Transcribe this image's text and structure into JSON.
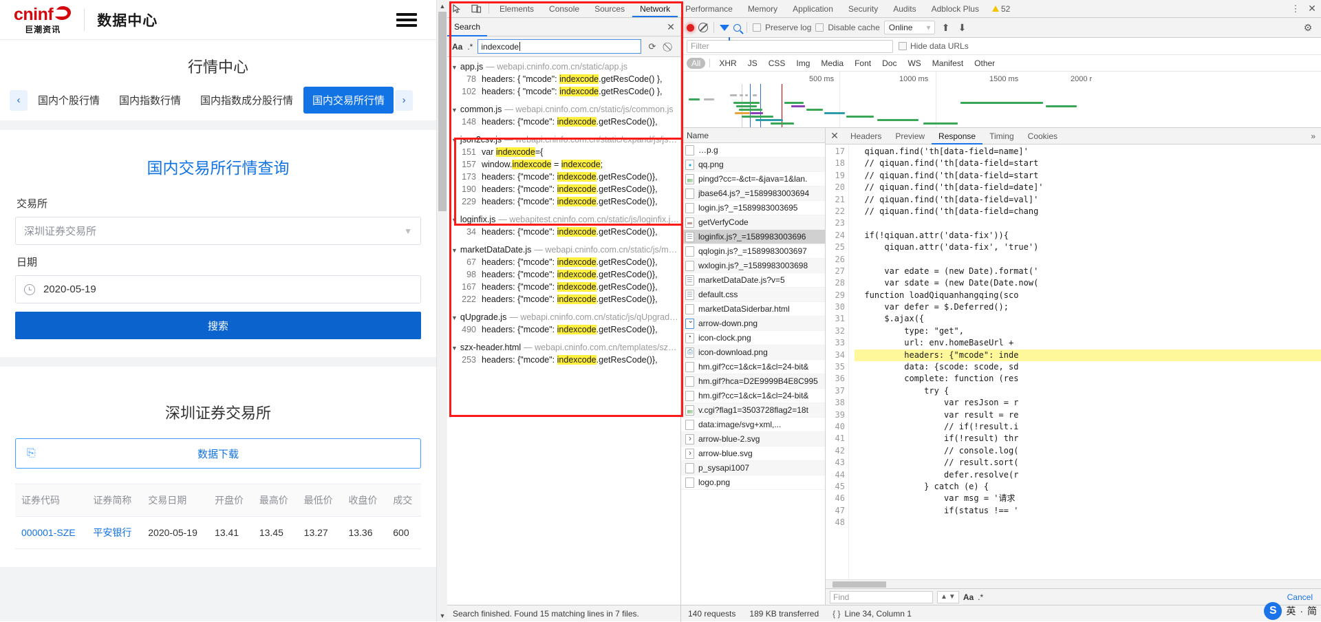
{
  "webpage": {
    "logo": {
      "top": "cninf",
      "bottom": "巨潮资讯"
    },
    "header_title": "数据中心",
    "nav": {
      "title": "行情中心",
      "prev_icon": "chevron-left-icon",
      "next_icon": "chevron-right-icon",
      "tabs": [
        {
          "label": "国内个股行情",
          "active": false
        },
        {
          "label": "国内指数行情",
          "active": false
        },
        {
          "label": "国内指数成分股行情",
          "active": false
        },
        {
          "label": "国内交易所行情",
          "active": true
        }
      ]
    },
    "query": {
      "title": "国内交易所行情查询",
      "exchange_label": "交易所",
      "exchange_value": "深圳证券交易所",
      "date_label": "日期",
      "date_value": "2020-05-19",
      "search_button": "搜索"
    },
    "results": {
      "title": "深圳证券交易所",
      "download_button": "数据下载",
      "download_icon": "download-icon",
      "columns": [
        "证券代码",
        "证券简称",
        "交易日期",
        "开盘价",
        "最高价",
        "最低价",
        "收盘价",
        "成交"
      ],
      "rows": [
        [
          "000001-SZE",
          "平安银行",
          "2020-05-19",
          "13.41",
          "13.45",
          "13.27",
          "13.36",
          "600"
        ]
      ]
    }
  },
  "devtools": {
    "tabs": [
      {
        "label": "Elements",
        "active": false
      },
      {
        "label": "Console",
        "active": false
      },
      {
        "label": "Sources",
        "active": false
      },
      {
        "label": "Network",
        "active": true
      },
      {
        "label": "Performance",
        "active": false
      },
      {
        "label": "Memory",
        "active": false
      },
      {
        "label": "Application",
        "active": false
      },
      {
        "label": "Security",
        "active": false
      },
      {
        "label": "Audits",
        "active": false
      },
      {
        "label": "Adblock Plus",
        "active": false
      }
    ],
    "warning_count": "52",
    "inspect_icon": "inspect-element-icon",
    "device_icon": "device-toolbar-icon",
    "kebab_icon": "more-options-icon",
    "close_icon": "close-icon",
    "search": {
      "panel_label": "Search",
      "close_icon": "close-icon",
      "match_case_label": "Aa",
      "regex_label": ".*",
      "query": "indexcode",
      "refresh_icon": "refresh-icon",
      "clear_icon": "clear-icon",
      "status": "Search finished. Found 15 matching lines in 7 files.",
      "files": [
        {
          "name": "app.js",
          "url": "webapi.cninfo.com.cn/static/app.js",
          "lines": [
            {
              "no": "78",
              "pre": "headers: { \"mcode\": ",
              "hit": "indexcode",
              "post": ".getResCode() },"
            },
            {
              "no": "102",
              "pre": "headers: { \"mcode\": ",
              "hit": "indexcode",
              "post": ".getResCode() },"
            }
          ]
        },
        {
          "name": "common.js",
          "url": "webapi.cninfo.com.cn/static/js/common.js",
          "lines": [
            {
              "no": "148",
              "pre": "headers: {\"mcode\": ",
              "hit": "indexcode",
              "post": ".getResCode()},"
            }
          ]
        },
        {
          "name": "json2csv.js",
          "url": "webapi.cninfo.com.cn/static/expand/js/jso…",
          "lines": [
            {
              "no": "151",
              "pre": "var ",
              "hit": "indexcode",
              "post": "={"
            },
            {
              "no": "157",
              "pre": "window.",
              "hit": "indexcode",
              "post": " = ",
              "hit2": "indexcode",
              "post2": ";"
            },
            {
              "no": "173",
              "pre": "headers: {\"mcode\": ",
              "hit": "indexcode",
              "post": ".getResCode()},"
            },
            {
              "no": "190",
              "pre": "headers: {\"mcode\": ",
              "hit": "indexcode",
              "post": ".getResCode()},"
            },
            {
              "no": "229",
              "pre": "headers: {\"mcode\": ",
              "hit": "indexcode",
              "post": ".getResCode()},"
            }
          ]
        },
        {
          "name": "loginfix.js",
          "url": "webapitest.cninfo.com.cn/static/js/loginfix.js…",
          "lines": [
            {
              "no": "34",
              "pre": "headers: {\"mcode\": ",
              "hit": "indexcode",
              "post": ".getResCode()},"
            }
          ]
        },
        {
          "name": "marketDataDate.js",
          "url": "webapi.cninfo.com.cn/static/js/mar…",
          "lines": [
            {
              "no": "67",
              "pre": "headers: {\"mcode\": ",
              "hit": "indexcode",
              "post": ".getResCode()},"
            },
            {
              "no": "98",
              "pre": "headers: {\"mcode\": ",
              "hit": "indexcode",
              "post": ".getResCode()},"
            },
            {
              "no": "167",
              "pre": "headers: {\"mcode\": ",
              "hit": "indexcode",
              "post": ".getResCode()},"
            },
            {
              "no": "222",
              "pre": "headers: {\"mcode\": ",
              "hit": "indexcode",
              "post": ".getResCode()},"
            }
          ]
        },
        {
          "name": "qUpgrade.js",
          "url": "webapi.cninfo.com.cn/static/js/qUpgrade…",
          "lines": [
            {
              "no": "490",
              "pre": "headers: {\"mcode\": ",
              "hit": "indexcode",
              "post": ".getResCode()},"
            }
          ]
        },
        {
          "name": "szx-header.html",
          "url": "webapi.cninfo.com.cn/templates/szx-…",
          "lines": [
            {
              "no": "253",
              "pre": "headers: {\"mcode\": ",
              "hit": "indexcode",
              "post": ".getResCode()},"
            }
          ]
        }
      ]
    },
    "network": {
      "record_icon": "record-button-icon",
      "clear_icon": "clear-icon",
      "filter_icon": "filter-icon",
      "search_icon": "search-icon",
      "preserve_log_label": "Preserve log",
      "disable_cache_label": "Disable cache",
      "throttle_value": "Online",
      "throttle_chevron": "chevron-down-icon",
      "import_icon": "import-har-icon",
      "export_icon": "export-har-icon",
      "settings_icon": "gear-icon",
      "filter_placeholder": "Filter",
      "hide_data_urls_label": "Hide data URLs",
      "type_filters": [
        "All",
        "XHR",
        "JS",
        "CSS",
        "Img",
        "Media",
        "Font",
        "Doc",
        "WS",
        "Manifest",
        "Other"
      ],
      "active_type_filter": "All",
      "timeline_ticks": [
        "500 ms",
        "1000 ms",
        "1500 ms",
        "2000 r"
      ],
      "name_column": "Name",
      "requests": [
        {
          "name": "…p.g",
          "icon": "file-icon",
          "selected": false
        },
        {
          "name": "qq.png",
          "icon": "image-icon",
          "selected": false
        },
        {
          "name": "pingd?cc=-&ct=-&java=1&lan.",
          "icon": "image-icon",
          "selected": false
        },
        {
          "name": "jbase64.js?_=1589983003694",
          "icon": "file-icon",
          "selected": false
        },
        {
          "name": "login.js?_=1589983003695",
          "icon": "file-icon",
          "selected": false
        },
        {
          "name": "getVerfyCode",
          "icon": "doc-icon",
          "selected": false
        },
        {
          "name": "loginfix.js?_=1589983003696",
          "icon": "doc-icon",
          "selected": true
        },
        {
          "name": "qqlogin.js?_=1589983003697",
          "icon": "file-icon",
          "selected": false
        },
        {
          "name": "wxlogin.js?_=1589983003698",
          "icon": "file-icon",
          "selected": false
        },
        {
          "name": "marketDataDate.js?v=5",
          "icon": "doc-icon",
          "selected": false
        },
        {
          "name": "default.css",
          "icon": "doc-icon",
          "selected": false
        },
        {
          "name": "marketDataSiderbar.html",
          "icon": "file-icon",
          "selected": false
        },
        {
          "name": "arrow-down.png",
          "icon": "arrow-down-icon",
          "selected": false
        },
        {
          "name": "icon-clock.png",
          "icon": "clock-icon",
          "selected": false
        },
        {
          "name": "icon-download.png",
          "icon": "download-icon",
          "selected": false
        },
        {
          "name": "hm.gif?cc=1&ck=1&cl=24-bit&",
          "icon": "file-icon",
          "selected": false
        },
        {
          "name": "hm.gif?hca=D2E9999B4E8C995",
          "icon": "file-icon",
          "selected": false
        },
        {
          "name": "hm.gif?cc=1&ck=1&cl=24-bit&",
          "icon": "file-icon",
          "selected": false
        },
        {
          "name": "v.cgi?flag1=3503728flag2=18t",
          "icon": "image-icon",
          "selected": false
        },
        {
          "name": "data:image/svg+xml,...",
          "icon": "file-icon",
          "selected": false
        },
        {
          "name": "arrow-blue-2.svg",
          "icon": "arrow-icon",
          "selected": false
        },
        {
          "name": "arrow-blue.svg",
          "icon": "arrow-icon",
          "selected": false
        },
        {
          "name": "p_sysapi1007",
          "icon": "file-icon",
          "selected": false
        },
        {
          "name": "logo.png",
          "icon": "file-icon",
          "selected": false
        }
      ],
      "status": {
        "requests": "140 requests",
        "transferred": "189 KB transferred",
        "cursor": "Line 34, Column 1"
      }
    },
    "detail": {
      "close_icon": "close-icon",
      "tabs": [
        {
          "label": "Headers",
          "active": false
        },
        {
          "label": "Preview",
          "active": false
        },
        {
          "label": "Response",
          "active": true
        },
        {
          "label": "Timing",
          "active": false
        },
        {
          "label": "Cookies",
          "active": false
        }
      ],
      "more_icon": "more-tabs-icon",
      "first_line_no": 17,
      "code_lines": [
        {
          "text": "  qiquan.find('th[data-field=name]'",
          "hl": false
        },
        {
          "text": "  // qiquan.find('th[data-field=start",
          "hl": false
        },
        {
          "text": "  // qiquan.find('th[data-field=start",
          "hl": false
        },
        {
          "text": "  // qiquan.find('th[data-field=date]'",
          "hl": false
        },
        {
          "text": "  // qiquan.find('th[data-field=val]'",
          "hl": false
        },
        {
          "text": "  // qiquan.find('th[data-field=chang",
          "hl": false
        },
        {
          "text": "",
          "hl": false
        },
        {
          "text": "  if(!qiquan.attr('data-fix')){",
          "hl": false
        },
        {
          "text": "      qiquan.attr('data-fix', 'true')",
          "hl": false
        },
        {
          "text": "",
          "hl": false
        },
        {
          "text": "      var edate = (new Date).format('",
          "hl": false
        },
        {
          "text": "      var sdate = (new Date(Date.now(",
          "hl": false
        },
        {
          "text": "  function loadQiquanhangqing(sco",
          "hl": false
        },
        {
          "text": "      var defer = $.Deferred();",
          "hl": false
        },
        {
          "text": "      $.ajax({",
          "hl": false
        },
        {
          "text": "          type: \"get\",",
          "hl": false
        },
        {
          "text": "          url: env.homeBaseUrl +",
          "hl": false
        },
        {
          "text": "          headers: {\"mcode\": inde",
          "hl": true
        },
        {
          "text": "          data: {scode: scode, sd",
          "hl": false
        },
        {
          "text": "          complete: function (res",
          "hl": false
        },
        {
          "text": "              try {",
          "hl": false
        },
        {
          "text": "                  var resJson = r",
          "hl": false
        },
        {
          "text": "                  var result = re",
          "hl": false
        },
        {
          "text": "                  // if(!result.i",
          "hl": false
        },
        {
          "text": "                  if(!result) thr",
          "hl": false
        },
        {
          "text": "                  // console.log(",
          "hl": false
        },
        {
          "text": "                  // result.sort(",
          "hl": false
        },
        {
          "text": "                  defer.resolve(r",
          "hl": false
        },
        {
          "text": "              } catch (e) {",
          "hl": false
        },
        {
          "text": "                  var msg = '请求",
          "hl": false
        },
        {
          "text": "                  if(status !== '",
          "hl": false
        },
        {
          "text": "",
          "hl": false
        }
      ],
      "find_placeholder": "Find",
      "find_prev_icon": "chevron-up-icon",
      "find_next_icon": "chevron-down-icon",
      "find_match_case": "Aa",
      "find_regex": ".*",
      "cancel_label": "Cancel"
    }
  },
  "ime": {
    "logo": "S",
    "text1": "英",
    "dot": "·",
    "text2": "简"
  }
}
